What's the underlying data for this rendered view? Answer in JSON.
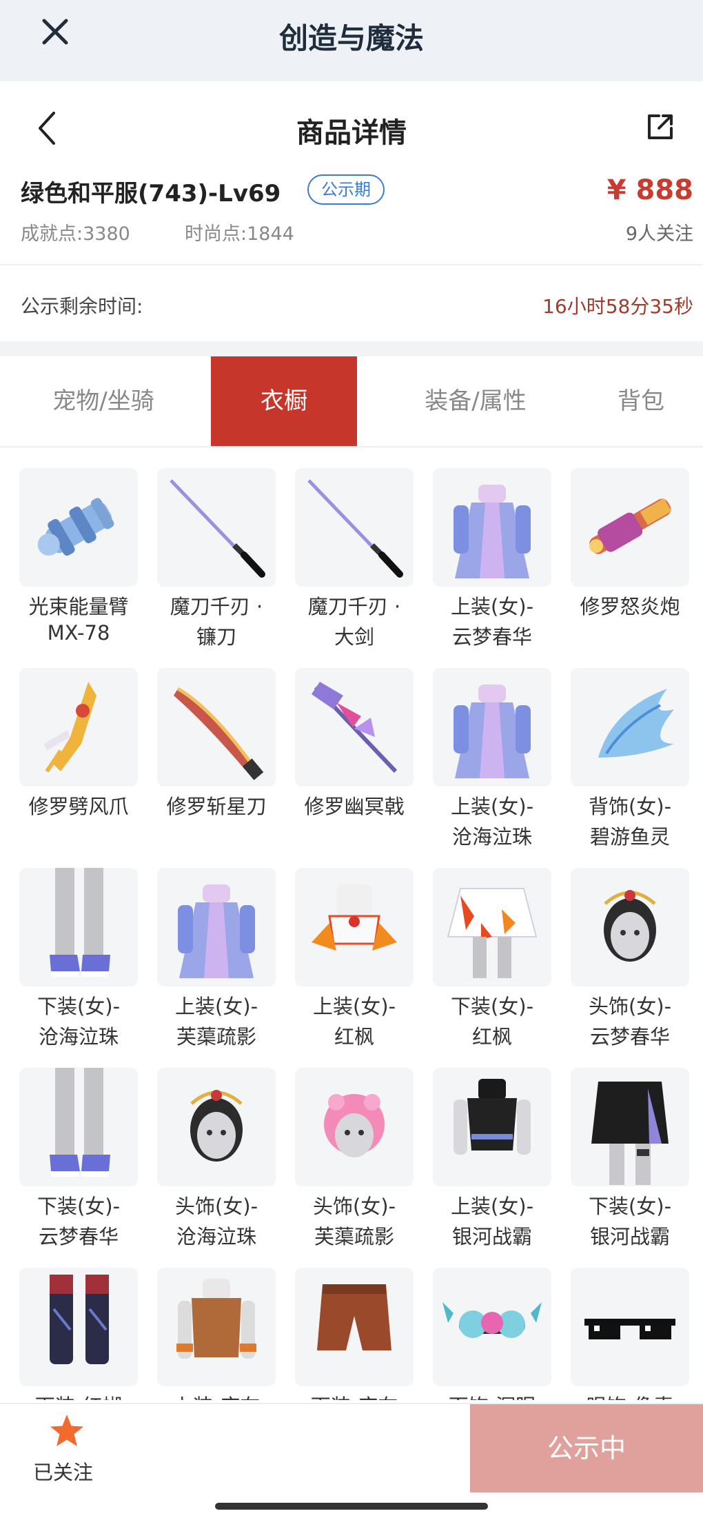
{
  "app": {
    "title": "创造与魔法"
  },
  "nav": {
    "title": "商品详情"
  },
  "product": {
    "name": "绿色和平服(743)-Lv69",
    "badge": "公示期",
    "price": "¥ 888",
    "achievement": "成就点:3380",
    "fashion": "时尚点:1844",
    "followers": "9人关注"
  },
  "countdown": {
    "label": "公示剩余时间:",
    "time": "16小时58分35秒"
  },
  "tabs": [
    {
      "label": "宠物/坐骑"
    },
    {
      "label": "衣橱"
    },
    {
      "label": "装备/属性"
    },
    {
      "label": "背包"
    }
  ],
  "active_tab_index": 1,
  "items": [
    {
      "line1": "光束能量臂",
      "line2": "MX-78",
      "icon": "beam-arm-icon"
    },
    {
      "line1": "魔刀千刃 ·",
      "line2": "镰刀",
      "icon": "sword-icon"
    },
    {
      "line1": "魔刀千刃 ·",
      "line2": "大剑",
      "icon": "sword-icon"
    },
    {
      "line1": "上装(女)-",
      "line2": "云梦春华",
      "icon": "dress-icon"
    },
    {
      "line1": "修罗怒炎炮",
      "line2": "",
      "icon": "cannon-icon"
    },
    {
      "line1": "修罗劈风爪",
      "line2": "",
      "icon": "claw-icon"
    },
    {
      "line1": "修罗斩星刀",
      "line2": "",
      "icon": "blade-icon"
    },
    {
      "line1": "修罗幽冥戟",
      "line2": "",
      "icon": "halberd-icon"
    },
    {
      "line1": "上装(女)-",
      "line2": "沧海泣珠",
      "icon": "dress-icon"
    },
    {
      "line1": "背饰(女)-",
      "line2": "碧游鱼灵",
      "icon": "wing-icon"
    },
    {
      "line1": "下装(女)-",
      "line2": "沧海泣珠",
      "icon": "legs-icon"
    },
    {
      "line1": "上装(女)-",
      "line2": "芙蕖疏影",
      "icon": "dress-icon"
    },
    {
      "line1": "上装(女)-",
      "line2": "红枫",
      "icon": "top-icon"
    },
    {
      "line1": "下装(女)-",
      "line2": "红枫",
      "icon": "skirt-icon"
    },
    {
      "line1": "头饰(女)-",
      "line2": "云梦春华",
      "icon": "head-icon"
    },
    {
      "line1": "下装(女)-",
      "line2": "云梦春华",
      "icon": "legs-icon"
    },
    {
      "line1": "头饰(女)-",
      "line2": "沧海泣珠",
      "icon": "head-icon"
    },
    {
      "line1": "头饰(女)-",
      "line2": "芙蕖疏影",
      "icon": "head-pink-icon"
    },
    {
      "line1": "上装(女)-",
      "line2": "银河战霸",
      "icon": "top-dark-icon"
    },
    {
      "line1": "下装(女)-",
      "line2": "银河战霸",
      "icon": "skirt-dark-icon"
    },
    {
      "line1": "下装-红蝴",
      "line2": "",
      "icon": "boots-icon"
    },
    {
      "line1": "上装-麻布",
      "line2": "",
      "icon": "top-brown-icon"
    },
    {
      "line1": "下装-麻布",
      "line2": "",
      "icon": "shorts-icon"
    },
    {
      "line1": "面饰-深眠",
      "line2": "",
      "icon": "mask-icon"
    },
    {
      "line1": "眼饰-像素",
      "line2": "",
      "icon": "glasses-icon"
    }
  ],
  "bottom": {
    "follow_label": "已关注",
    "cta_label": "公示中"
  },
  "colors": {
    "accent": "#c7362b",
    "price": "#c83b30",
    "badge": "#3a7bd5",
    "cta": "#e0a19c"
  }
}
